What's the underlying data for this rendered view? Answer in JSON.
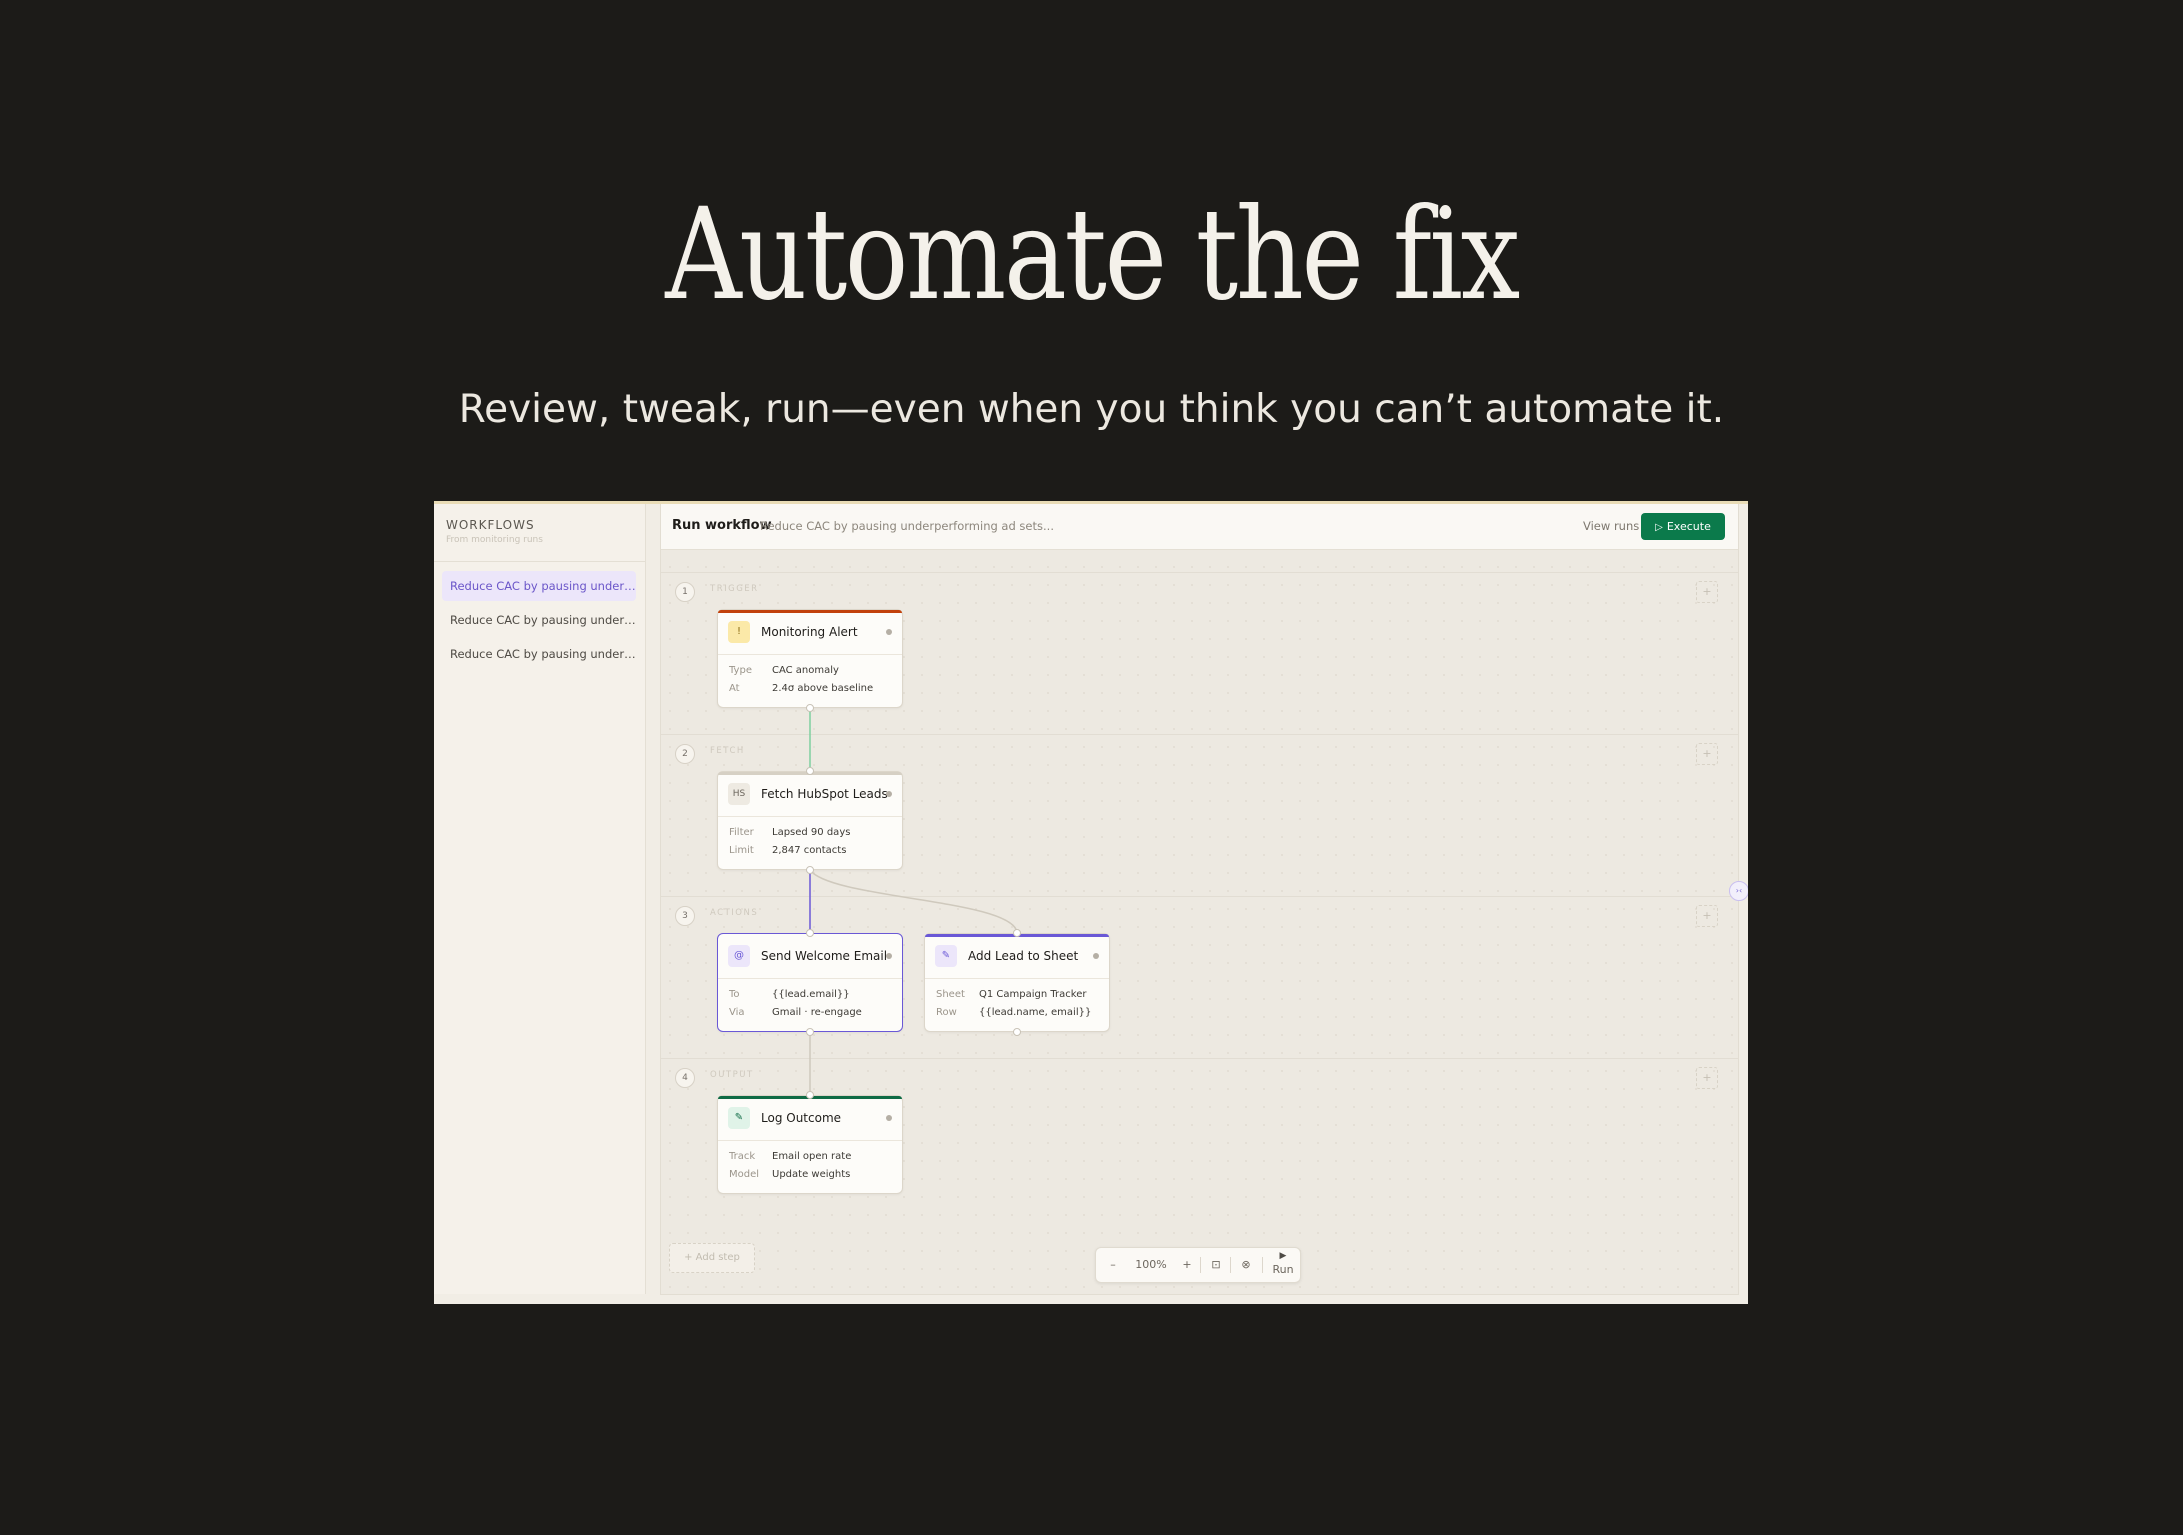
{
  "hero": {
    "title": "Automate the fix",
    "subtitle": "Review, tweak, run—even when you think you can’t automate it."
  },
  "sidebar": {
    "title": "WORKFLOWS",
    "subtitle": "From monitoring runs",
    "items": [
      {
        "label": "Reduce CAC by pausing underperforming ad sets",
        "active": true
      },
      {
        "label": "Reduce CAC by pausing underperforming ad sets",
        "active": false
      },
      {
        "label": "Reduce CAC by pausing underperforming ad sets",
        "active": false
      }
    ]
  },
  "topbar": {
    "title": "Run workflow",
    "description": "Reduce CAC by pausing underperforming ad sets...",
    "view_runs": "View runs",
    "execute_label": "Execute",
    "execute_color": "#0b7a4b"
  },
  "lanes": [
    {
      "number": "1",
      "label": "TRIGGER",
      "plus": "+"
    },
    {
      "number": "2",
      "label": "FETCH",
      "plus": "+"
    },
    {
      "number": "3",
      "label": "ACTIONS",
      "plus": "+"
    },
    {
      "number": "4",
      "label": "OUTPUT",
      "plus": "+"
    }
  ],
  "nodes": {
    "monitoring_alert": {
      "icon": "!",
      "icon_name": "alert-icon",
      "accent": "#c2410c",
      "title": "Monitoring Alert",
      "rows": [
        {
          "k": "Type",
          "v": "CAC anomaly"
        },
        {
          "k": "At",
          "v": "2.4σ above baseline"
        }
      ]
    },
    "fetch_hubspot": {
      "icon": "HS",
      "icon_name": "hubspot-icon",
      "accent": "#d6d0c4",
      "title": "Fetch HubSpot Leads",
      "rows": [
        {
          "k": "Filter",
          "v": "Lapsed 90 days"
        },
        {
          "k": "Limit",
          "v": "2,847 contacts"
        }
      ]
    },
    "send_email": {
      "icon": "@",
      "icon_name": "email-icon",
      "accent": "#6a58d6",
      "title": "Send Welcome Email",
      "rows": [
        {
          "k": "To",
          "v": "{{lead.email}}"
        },
        {
          "k": "Via",
          "v": "Gmail · re-engage"
        }
      ]
    },
    "add_sheet": {
      "icon": "✎",
      "icon_name": "sheet-icon",
      "accent": "#6a58d6",
      "title": "Add Lead to Sheet",
      "rows": [
        {
          "k": "Sheet",
          "v": "Q1 Campaign Tracker"
        },
        {
          "k": "Row",
          "v": "{{lead.name, email}}"
        }
      ]
    },
    "log_outcome": {
      "icon": "✎",
      "icon_name": "log-icon",
      "accent": "#0f6b45",
      "title": "Log Outcome",
      "rows": [
        {
          "k": "Track",
          "v": "Email open rate"
        },
        {
          "k": "Model",
          "v": "Update weights"
        }
      ]
    }
  },
  "add_step": "+ Add step",
  "zoom": {
    "minus": "–",
    "level": "100%",
    "plus": "+",
    "fit_icon": "fit-icon",
    "reset_icon": "reset-icon",
    "run_label": "Run"
  },
  "colors": {
    "background": "#1c1b18",
    "accent_purple": "#6a58d6",
    "edge_green": "#7fcf9f",
    "edge_purple": "#6a58d6",
    "edge_gray": "#cfc9bd"
  }
}
